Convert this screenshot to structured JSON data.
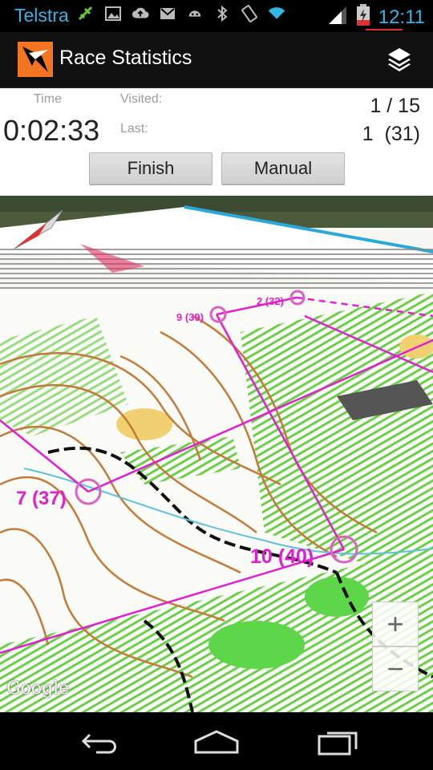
{
  "status_bar": {
    "carrier": "Telstra",
    "time": "12:11",
    "icons": [
      "usb-icon",
      "image-icon",
      "upload-icon",
      "gmail-icon",
      "android-icon",
      "bluetooth-icon",
      "rotate-icon",
      "wifi-icon",
      "signal-icon",
      "battery-icon"
    ]
  },
  "action_bar": {
    "title": "Race Statistics",
    "layers_icon": "layers-icon"
  },
  "stats": {
    "time_label": "Time",
    "time_value": "0:02:33",
    "visited_label": "Visited:",
    "visited_value": "1 / 15",
    "last_label": "Last:",
    "last_value": "1  (31)",
    "finish_label": "Finish",
    "manual_label": "Manual"
  },
  "map": {
    "controls": [
      {
        "label": "7 (37)"
      },
      {
        "label": "10 (40)"
      },
      {
        "label": "9 (39)"
      },
      {
        "label": "2 (32)"
      }
    ],
    "zoom_in": "+",
    "zoom_out": "−",
    "attribution": "Google"
  },
  "nav_bar": {
    "back_icon": "back-icon",
    "home_icon": "home-icon",
    "recents_icon": "recents-icon"
  },
  "colors": {
    "accent": "#33b5e5",
    "brand": "#f37521",
    "course": "#e020d0"
  }
}
